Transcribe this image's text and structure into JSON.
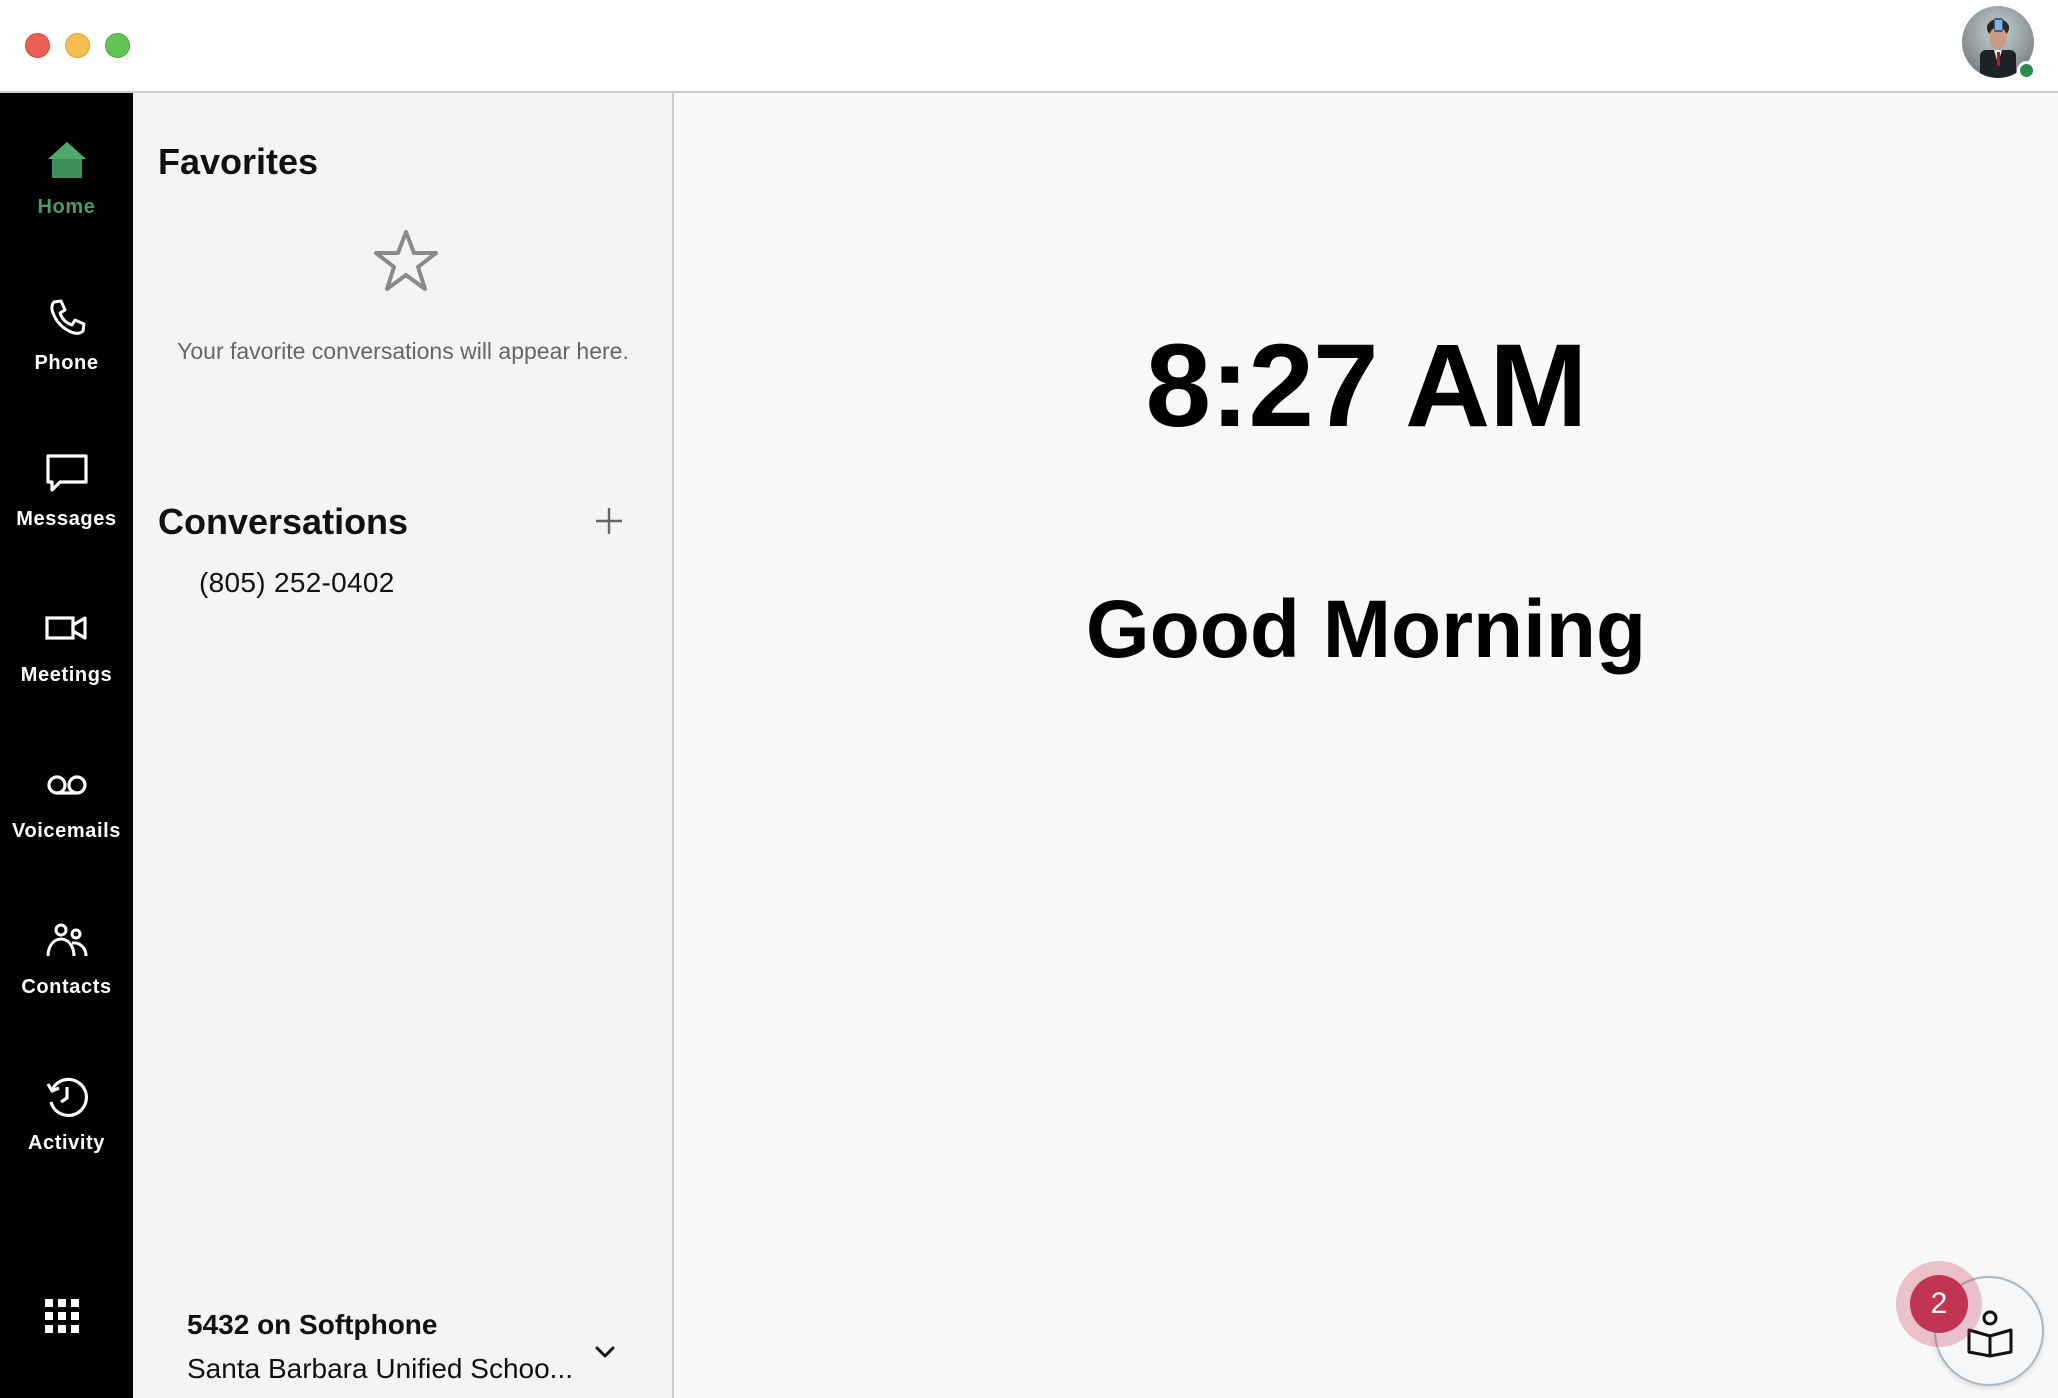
{
  "window": {
    "traffic_lights": [
      "close",
      "minimize",
      "zoom"
    ],
    "status_color": "#2f8a4e"
  },
  "nav": {
    "active_color": "#4e9a65",
    "items": [
      {
        "label": "Home",
        "icon": "home-icon",
        "active": true
      },
      {
        "label": "Phone",
        "icon": "phone-icon",
        "active": false
      },
      {
        "label": "Messages",
        "icon": "message-icon",
        "active": false
      },
      {
        "label": "Meetings",
        "icon": "video-camera-icon",
        "active": false
      },
      {
        "label": "Voicemails",
        "icon": "voicemail-icon",
        "active": false
      },
      {
        "label": "Contacts",
        "icon": "contacts-icon",
        "active": false
      },
      {
        "label": "Activity",
        "icon": "history-icon",
        "active": false
      }
    ],
    "apps_icon": "app-grid-icon"
  },
  "favorites": {
    "title": "Favorites",
    "empty_icon": "star-icon",
    "empty_text": "Your favorite conversations will appear here."
  },
  "conversations": {
    "title": "Conversations",
    "add_icon": "plus-icon",
    "items": [
      "(805) 252-0402"
    ]
  },
  "line": {
    "name": "5432 on Softphone",
    "organization": "Santa Barbara Unified Schoo...",
    "dropdown_icon": "chevron-down-icon"
  },
  "main": {
    "time": "8:27 AM",
    "greeting": "Good Morning"
  },
  "help": {
    "badge_count": "2",
    "badge_color": "#c03552",
    "icon": "learning-book-icon"
  }
}
